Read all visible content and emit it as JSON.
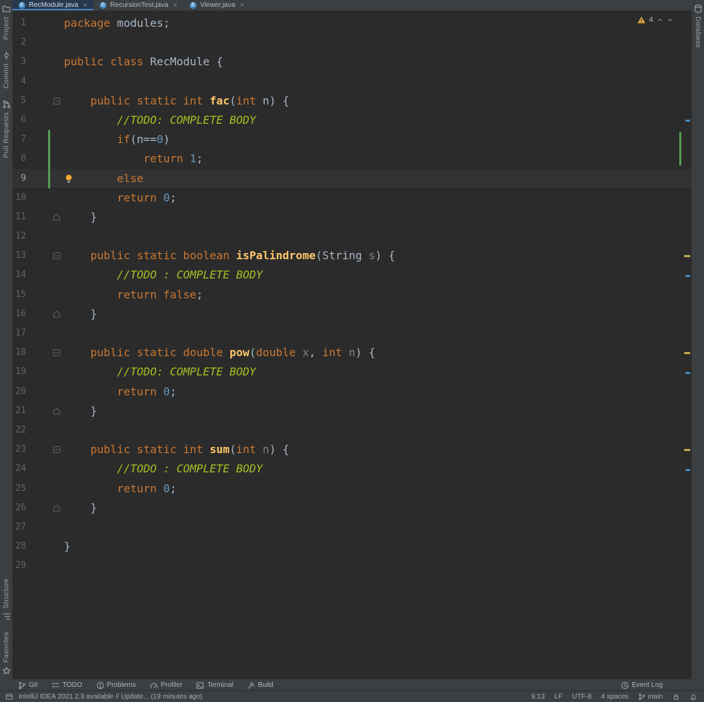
{
  "tabs": [
    {
      "label": "RecModule.java",
      "icon": "java-class-icon",
      "close_icon": "close-icon",
      "active": true
    },
    {
      "label": "RecursionTest.java",
      "icon": "java-class-icon",
      "close_icon": "close-icon",
      "active": false
    },
    {
      "label": "Viewer.java",
      "icon": "java-class-icon",
      "close_icon": "close-icon",
      "active": false
    }
  ],
  "left_stripe": {
    "top": [
      {
        "label": "Project",
        "icon": "project-icon"
      },
      {
        "label": "Commit",
        "icon": "commit-icon"
      },
      {
        "label": "Pull Requests",
        "icon": "pull-requests-icon"
      }
    ],
    "bottom": [
      {
        "label": "Structure",
        "icon": "structure-icon"
      },
      {
        "label": "Favorites",
        "icon": "favorites-icon"
      }
    ]
  },
  "right_stripe": {
    "top": [
      {
        "label": "Database",
        "icon": "database-icon"
      }
    ]
  },
  "editor": {
    "inspection": {
      "warnings": "4"
    },
    "colors": {
      "background": "#2B2B2B",
      "chrome": "#3C3F41",
      "caret_row": "#323232",
      "keyword": "#CC7832",
      "method": "#FFC66B",
      "number": "#6897BB",
      "todo_comment": "#A8C023",
      "default_text": "#A9B7C6",
      "unused_symbol": "#7D8288",
      "line_number": "#606366",
      "active_tab_bg": "#26384E",
      "tab_underline": "#4A88C7",
      "change_marker": "#549E54",
      "warning_mark": "#C4AE4A",
      "todo_mark": "#3E8EC6"
    },
    "lines": [
      {
        "num": 1,
        "tokens": [
          [
            "k",
            "package"
          ],
          [
            "d",
            " modules;"
          ]
        ]
      },
      {
        "num": 2,
        "tokens": []
      },
      {
        "num": 3,
        "tokens": [
          [
            "k",
            "public"
          ],
          [
            "d",
            " "
          ],
          [
            "k",
            "class"
          ],
          [
            "d",
            " RecModule {"
          ]
        ]
      },
      {
        "num": 4,
        "tokens": []
      },
      {
        "num": 5,
        "fold": "start",
        "tokens": [
          [
            "d",
            "    "
          ],
          [
            "k",
            "public"
          ],
          [
            "d",
            " "
          ],
          [
            "k",
            "static"
          ],
          [
            "d",
            " "
          ],
          [
            "k",
            "int"
          ],
          [
            "d",
            " "
          ],
          [
            "m",
            "fac"
          ],
          [
            "d",
            "("
          ],
          [
            "k",
            "int"
          ],
          [
            "d",
            " n) {"
          ]
        ]
      },
      {
        "num": 6,
        "tokens": [
          [
            "d",
            "        "
          ],
          [
            "t",
            "//TODO: COMPLETE BODY"
          ]
        ]
      },
      {
        "num": 7,
        "changed": true,
        "tokens": [
          [
            "d",
            "        "
          ],
          [
            "k",
            "if"
          ],
          [
            "d",
            "(n=="
          ],
          [
            "n",
            "0"
          ],
          [
            "d",
            ")"
          ]
        ]
      },
      {
        "num": 8,
        "changed": true,
        "tokens": [
          [
            "d",
            "            "
          ],
          [
            "k",
            "return"
          ],
          [
            "d",
            " "
          ],
          [
            "n",
            "1"
          ],
          [
            "d",
            ";"
          ]
        ]
      },
      {
        "num": 9,
        "changed": true,
        "current": true,
        "bulb": true,
        "tokens": [
          [
            "d",
            "        "
          ],
          [
            "k",
            "else"
          ]
        ]
      },
      {
        "num": 10,
        "tokens": [
          [
            "d",
            "        "
          ],
          [
            "k",
            "return"
          ],
          [
            "d",
            " "
          ],
          [
            "n",
            "0"
          ],
          [
            "d",
            ";"
          ]
        ]
      },
      {
        "num": 11,
        "fold": "end",
        "tokens": [
          [
            "d",
            "    }"
          ]
        ]
      },
      {
        "num": 12,
        "tokens": []
      },
      {
        "num": 13,
        "fold": "start",
        "tokens": [
          [
            "d",
            "    "
          ],
          [
            "k",
            "public"
          ],
          [
            "d",
            " "
          ],
          [
            "k",
            "static"
          ],
          [
            "d",
            " "
          ],
          [
            "k",
            "boolean"
          ],
          [
            "d",
            " "
          ],
          [
            "m",
            "isPalindrome"
          ],
          [
            "d",
            "(String "
          ],
          [
            "g",
            "s"
          ],
          [
            "d",
            ") {"
          ]
        ]
      },
      {
        "num": 14,
        "tokens": [
          [
            "d",
            "        "
          ],
          [
            "t",
            "//TODO : COMPLETE BODY"
          ]
        ]
      },
      {
        "num": 15,
        "tokens": [
          [
            "d",
            "        "
          ],
          [
            "k",
            "return"
          ],
          [
            "d",
            " "
          ],
          [
            "k",
            "false"
          ],
          [
            "d",
            ";"
          ]
        ]
      },
      {
        "num": 16,
        "fold": "end",
        "tokens": [
          [
            "d",
            "    }"
          ]
        ]
      },
      {
        "num": 17,
        "tokens": []
      },
      {
        "num": 18,
        "fold": "start",
        "tokens": [
          [
            "d",
            "    "
          ],
          [
            "k",
            "public"
          ],
          [
            "d",
            " "
          ],
          [
            "k",
            "static"
          ],
          [
            "d",
            " "
          ],
          [
            "k",
            "double"
          ],
          [
            "d",
            " "
          ],
          [
            "m",
            "pow"
          ],
          [
            "d",
            "("
          ],
          [
            "k",
            "double"
          ],
          [
            "d",
            " "
          ],
          [
            "g",
            "x"
          ],
          [
            "d",
            ", "
          ],
          [
            "k",
            "int"
          ],
          [
            "d",
            " "
          ],
          [
            "g",
            "n"
          ],
          [
            "d",
            ") {"
          ]
        ]
      },
      {
        "num": 19,
        "tokens": [
          [
            "d",
            "        "
          ],
          [
            "t",
            "//TODO: COMPLETE BODY"
          ]
        ]
      },
      {
        "num": 20,
        "tokens": [
          [
            "d",
            "        "
          ],
          [
            "k",
            "return"
          ],
          [
            "d",
            " "
          ],
          [
            "n",
            "0"
          ],
          [
            "d",
            ";"
          ]
        ]
      },
      {
        "num": 21,
        "fold": "end",
        "tokens": [
          [
            "d",
            "    }"
          ]
        ]
      },
      {
        "num": 22,
        "tokens": []
      },
      {
        "num": 23,
        "fold": "start",
        "tokens": [
          [
            "d",
            "    "
          ],
          [
            "k",
            "public"
          ],
          [
            "d",
            " "
          ],
          [
            "k",
            "static"
          ],
          [
            "d",
            " "
          ],
          [
            "k",
            "int"
          ],
          [
            "d",
            " "
          ],
          [
            "m",
            "sum"
          ],
          [
            "d",
            "("
          ],
          [
            "k",
            "int"
          ],
          [
            "d",
            " "
          ],
          [
            "g",
            "n"
          ],
          [
            "d",
            ") {"
          ]
        ]
      },
      {
        "num": 24,
        "tokens": [
          [
            "d",
            "        "
          ],
          [
            "t",
            "//TODO : COMPLETE BODY"
          ]
        ]
      },
      {
        "num": 25,
        "tokens": [
          [
            "d",
            "        "
          ],
          [
            "k",
            "return"
          ],
          [
            "d",
            " "
          ],
          [
            "n",
            "0"
          ],
          [
            "d",
            ";"
          ]
        ]
      },
      {
        "num": 26,
        "fold": "end",
        "tokens": [
          [
            "d",
            "    }"
          ]
        ]
      },
      {
        "num": 27,
        "tokens": []
      },
      {
        "num": 28,
        "tokens": [
          [
            "d",
            "}"
          ]
        ]
      },
      {
        "num": 29,
        "tokens": []
      }
    ],
    "stripe_marks": {
      "warnings": [
        13,
        18,
        23
      ],
      "todos": [
        6,
        14,
        19,
        24
      ],
      "changes": {
        "from": 7,
        "to": 8
      }
    }
  },
  "bottom_bar": {
    "left": [
      {
        "label": "Git",
        "icon": "git-branch-icon"
      },
      {
        "label": "TODO",
        "icon": "todo-list-icon"
      },
      {
        "label": "Problems",
        "icon": "problems-icon"
      },
      {
        "label": "Profiler",
        "icon": "profiler-icon"
      },
      {
        "label": "Terminal",
        "icon": "terminal-icon"
      },
      {
        "label": "Build",
        "icon": "build-icon"
      }
    ],
    "right": [
      {
        "label": "Event Log",
        "icon": "event-log-icon"
      }
    ]
  },
  "status_bar": {
    "message": "IntelliJ IDEA 2021.2.3 available // Update... (19 minutes ago)",
    "position": "9:13",
    "line_ending": "LF",
    "encoding": "UTF-8",
    "indent": "4 spaces",
    "branch": "main"
  }
}
